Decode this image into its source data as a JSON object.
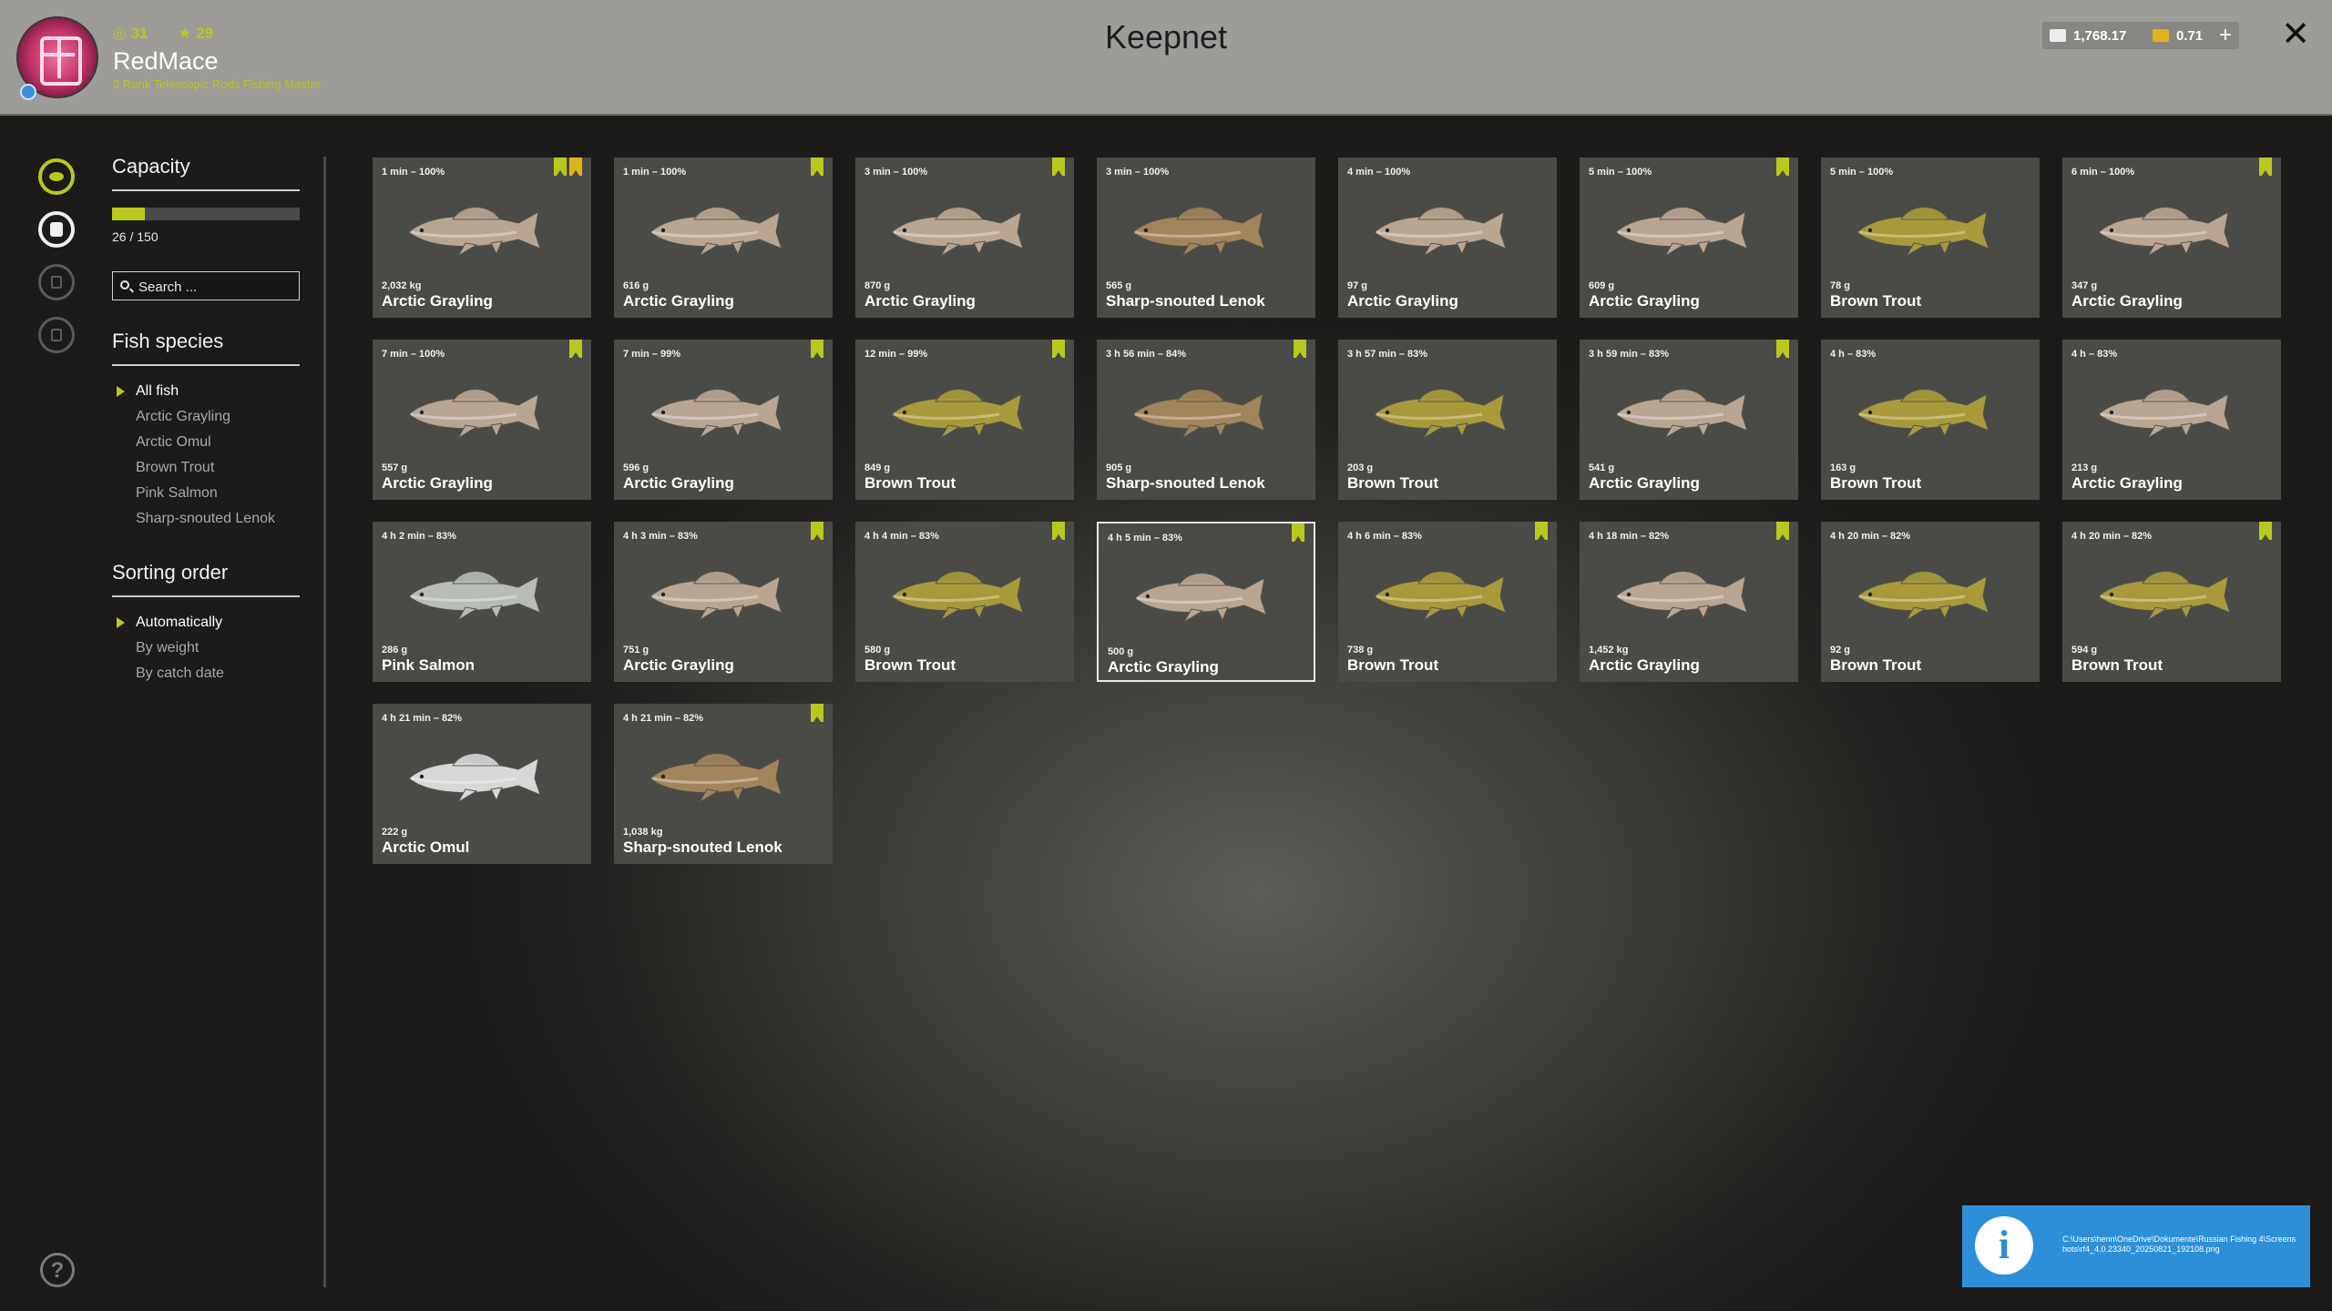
{
  "header": {
    "title": "Keepnet",
    "player": {
      "level": "31",
      "stars": "29",
      "name": "RedMace",
      "rank": "3 Rank Telescopic Rods Fishing Master"
    },
    "silver": "1,768.17",
    "gold": "0.71",
    "add_label": "+",
    "close_label": "✕"
  },
  "sidebar": {
    "capacity_title": "Capacity",
    "capacity_text": "26 / 150",
    "capacity_fraction": 0.1733,
    "search_placeholder": "Search ...",
    "species_title": "Fish species",
    "species": [
      "All fish",
      "Arctic Grayling",
      "Arctic Omul",
      "Brown Trout",
      "Pink Salmon",
      "Sharp-snouted Lenok"
    ],
    "sort_title": "Sorting order",
    "sort_options": [
      "Automatically",
      "By weight",
      "By catch date"
    ]
  },
  "colors": {
    "accent": "#b8c81e",
    "Arctic Grayling": "#b9a692",
    "Brown Trout": "#a89a3a",
    "Sharp-snouted Lenok": "#a1855a",
    "Pink Salmon": "#b7bcb6",
    "Arctic Omul": "#d5d8d6"
  },
  "fish": [
    {
      "time": "1 min – 100%",
      "weight": "2,032 kg",
      "name": "Arctic Grayling",
      "tags": [
        "green",
        "gold"
      ]
    },
    {
      "time": "1 min – 100%",
      "weight": "616 g",
      "name": "Arctic Grayling",
      "tags": [
        "green"
      ]
    },
    {
      "time": "3 min – 100%",
      "weight": "870 g",
      "name": "Arctic Grayling",
      "tags": [
        "green"
      ]
    },
    {
      "time": "3 min – 100%",
      "weight": "565 g",
      "name": "Sharp-snouted Lenok",
      "tags": []
    },
    {
      "time": "4 min – 100%",
      "weight": "97 g",
      "name": "Arctic Grayling",
      "tags": []
    },
    {
      "time": "5 min – 100%",
      "weight": "609 g",
      "name": "Arctic Grayling",
      "tags": [
        "green"
      ]
    },
    {
      "time": "5 min – 100%",
      "weight": "78 g",
      "name": "Brown Trout",
      "tags": []
    },
    {
      "time": "6 min – 100%",
      "weight": "347 g",
      "name": "Arctic Grayling",
      "tags": [
        "green"
      ]
    },
    {
      "time": "7 min – 100%",
      "weight": "557 g",
      "name": "Arctic Grayling",
      "tags": [
        "green"
      ]
    },
    {
      "time": "7 min – 99%",
      "weight": "596 g",
      "name": "Arctic Grayling",
      "tags": [
        "green"
      ]
    },
    {
      "time": "12 min – 99%",
      "weight": "849 g",
      "name": "Brown Trout",
      "tags": [
        "green"
      ]
    },
    {
      "time": "3 h 56 min – 84%",
      "weight": "905 g",
      "name": "Sharp-snouted Lenok",
      "tags": [
        "green"
      ]
    },
    {
      "time": "3 h 57 min – 83%",
      "weight": "203 g",
      "name": "Brown Trout",
      "tags": []
    },
    {
      "time": "3 h 59 min – 83%",
      "weight": "541 g",
      "name": "Arctic Grayling",
      "tags": [
        "green"
      ]
    },
    {
      "time": "4 h – 83%",
      "weight": "163 g",
      "name": "Brown Trout",
      "tags": []
    },
    {
      "time": "4 h – 83%",
      "weight": "213 g",
      "name": "Arctic Grayling",
      "tags": []
    },
    {
      "time": "4 h 2 min – 83%",
      "weight": "286 g",
      "name": "Pink Salmon",
      "tags": []
    },
    {
      "time": "4 h 3 min – 83%",
      "weight": "751 g",
      "name": "Arctic Grayling",
      "tags": [
        "green"
      ]
    },
    {
      "time": "4 h 4 min – 83%",
      "weight": "580 g",
      "name": "Brown Trout",
      "tags": [
        "green"
      ]
    },
    {
      "time": "4 h 5 min – 83%",
      "weight": "500 g",
      "name": "Arctic Grayling",
      "tags": [
        "green"
      ],
      "selected": true
    },
    {
      "time": "4 h 6 min – 83%",
      "weight": "738 g",
      "name": "Brown Trout",
      "tags": [
        "green"
      ]
    },
    {
      "time": "4 h 18 min – 82%",
      "weight": "1,452 kg",
      "name": "Arctic Grayling",
      "tags": [
        "green"
      ]
    },
    {
      "time": "4 h 20 min – 82%",
      "weight": "92 g",
      "name": "Brown Trout",
      "tags": []
    },
    {
      "time": "4 h 20 min – 82%",
      "weight": "594 g",
      "name": "Brown Trout",
      "tags": [
        "green"
      ]
    },
    {
      "time": "4 h 21 min – 82%",
      "weight": "222 g",
      "name": "Arctic Omul",
      "tags": []
    },
    {
      "time": "4 h 21 min – 82%",
      "weight": "1,038 kg",
      "name": "Sharp-snouted Lenok",
      "tags": [
        "green"
      ]
    }
  ],
  "notification": {
    "icon": "i",
    "text": "C:\\Users\\henn\\OneDrive\\Dokumente\\Russian Fishing 4\\Screenshots\\rf4_4.0.23340_20250821_192108.png"
  }
}
